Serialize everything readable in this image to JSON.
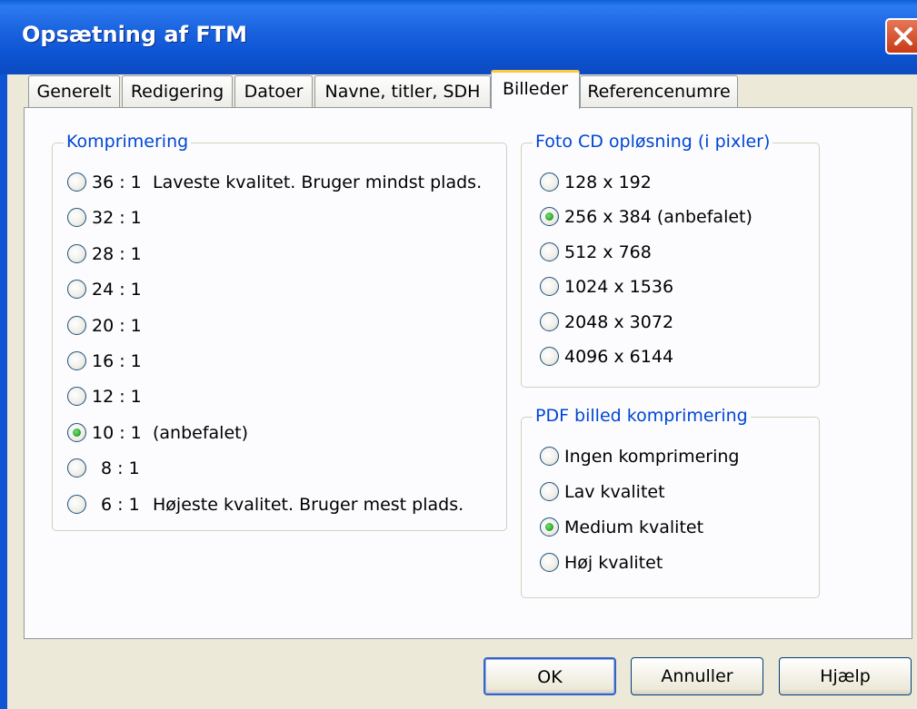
{
  "window": {
    "title": "Opsætning af FTM"
  },
  "tabs": [
    "Generelt",
    "Redigering",
    "Datoer",
    "Navne, titler, SDH",
    "Billeder",
    "Referencenumre"
  ],
  "compression": {
    "legend": "Komprimering",
    "options": [
      {
        "ratio": "36 : 1",
        "desc": "Laveste kvalitet. Bruger mindst plads.",
        "checked": false
      },
      {
        "ratio": "32 : 1",
        "desc": "",
        "checked": false
      },
      {
        "ratio": "28 : 1",
        "desc": "",
        "checked": false
      },
      {
        "ratio": "24 : 1",
        "desc": "",
        "checked": false
      },
      {
        "ratio": "20 : 1",
        "desc": "",
        "checked": false
      },
      {
        "ratio": "16 : 1",
        "desc": "",
        "checked": false
      },
      {
        "ratio": "12 : 1",
        "desc": "",
        "checked": false
      },
      {
        "ratio": "10 : 1",
        "desc": "(anbefalet)",
        "checked": true
      },
      {
        "ratio": "8 : 1",
        "desc": "",
        "checked": false
      },
      {
        "ratio": "6 : 1",
        "desc": "Højeste kvalitet. Bruger mest plads.",
        "checked": false
      }
    ]
  },
  "photocd": {
    "legend": "Foto CD opløsning (i pixler)",
    "options": [
      {
        "label": "128 x 192",
        "checked": false
      },
      {
        "label": "256 x 384 (anbefalet)",
        "checked": true
      },
      {
        "label": "512 x 768",
        "checked": false
      },
      {
        "label": "1024 x 1536",
        "checked": false
      },
      {
        "label": "2048 x 3072",
        "checked": false
      },
      {
        "label": "4096 x 6144",
        "checked": false
      }
    ]
  },
  "pdf": {
    "legend": "PDF billed komprimering",
    "options": [
      {
        "label": "Ingen komprimering",
        "checked": false
      },
      {
        "label": "Lav kvalitet",
        "checked": false
      },
      {
        "label": "Medium kvalitet",
        "checked": true
      },
      {
        "label": "Høj kvalitet",
        "checked": false
      }
    ]
  },
  "buttons": {
    "ok": "OK",
    "cancel": "Annuller",
    "help": "Hjælp"
  },
  "colors": {
    "titlebar": "#0d55d4",
    "legend_text": "#0046d5",
    "active_tab_accent": "#ffc83c",
    "close_button": "#c93a14"
  }
}
